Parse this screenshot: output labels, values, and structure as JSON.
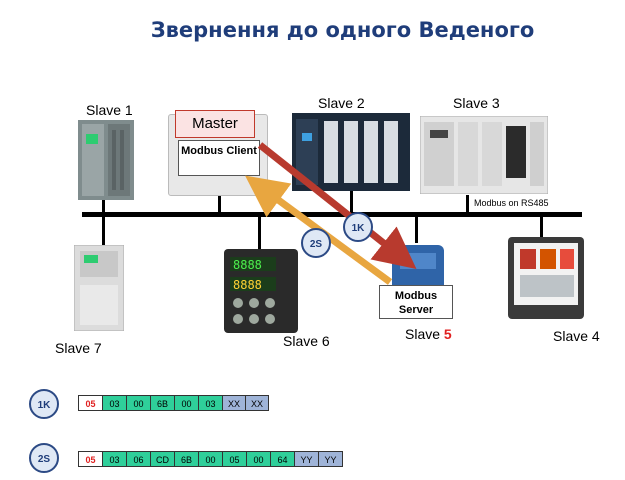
{
  "title": "Звернення до одного Веденого",
  "master": {
    "label": "Master",
    "client_label": "Modbus Client"
  },
  "server_label": "Modbus Server",
  "bus_label": "Modbus on RS485",
  "slaves": {
    "s1": "Slave 1",
    "s2": "Slave 2",
    "s3": "Slave 3",
    "s4": "Slave 4",
    "s5_prefix": "Slave ",
    "s5_number": "5",
    "s6": "Slave 6",
    "s7": "Slave 7"
  },
  "arrows": {
    "request": "1K",
    "response": "2S"
  },
  "frames": {
    "request": {
      "tag": "1K",
      "cells": [
        {
          "text": "05",
          "kind": "addr"
        },
        {
          "text": "03",
          "kind": "data"
        },
        {
          "text": "00",
          "kind": "data"
        },
        {
          "text": "6B",
          "kind": "data"
        },
        {
          "text": "00",
          "kind": "data"
        },
        {
          "text": "03",
          "kind": "data"
        },
        {
          "text": "XX",
          "kind": "crc"
        },
        {
          "text": "XX",
          "kind": "crc"
        }
      ]
    },
    "response": {
      "tag": "2S",
      "cells": [
        {
          "text": "05",
          "kind": "addr"
        },
        {
          "text": "03",
          "kind": "data"
        },
        {
          "text": "06",
          "kind": "data"
        },
        {
          "text": "CD",
          "kind": "data"
        },
        {
          "text": "6B",
          "kind": "data"
        },
        {
          "text": "00",
          "kind": "data"
        },
        {
          "text": "05",
          "kind": "data"
        },
        {
          "text": "00",
          "kind": "data"
        },
        {
          "text": "64",
          "kind": "data"
        },
        {
          "text": "YY",
          "kind": "crc"
        },
        {
          "text": "YY",
          "kind": "crc"
        }
      ]
    }
  },
  "colors": {
    "title": "#1f3d7a",
    "request_arrow": "#b83a2e",
    "response_arrow": "#e8a640",
    "data_cell": "#2fcf9a",
    "crc_cell": "#9fb4d8",
    "address": "#e02020"
  }
}
